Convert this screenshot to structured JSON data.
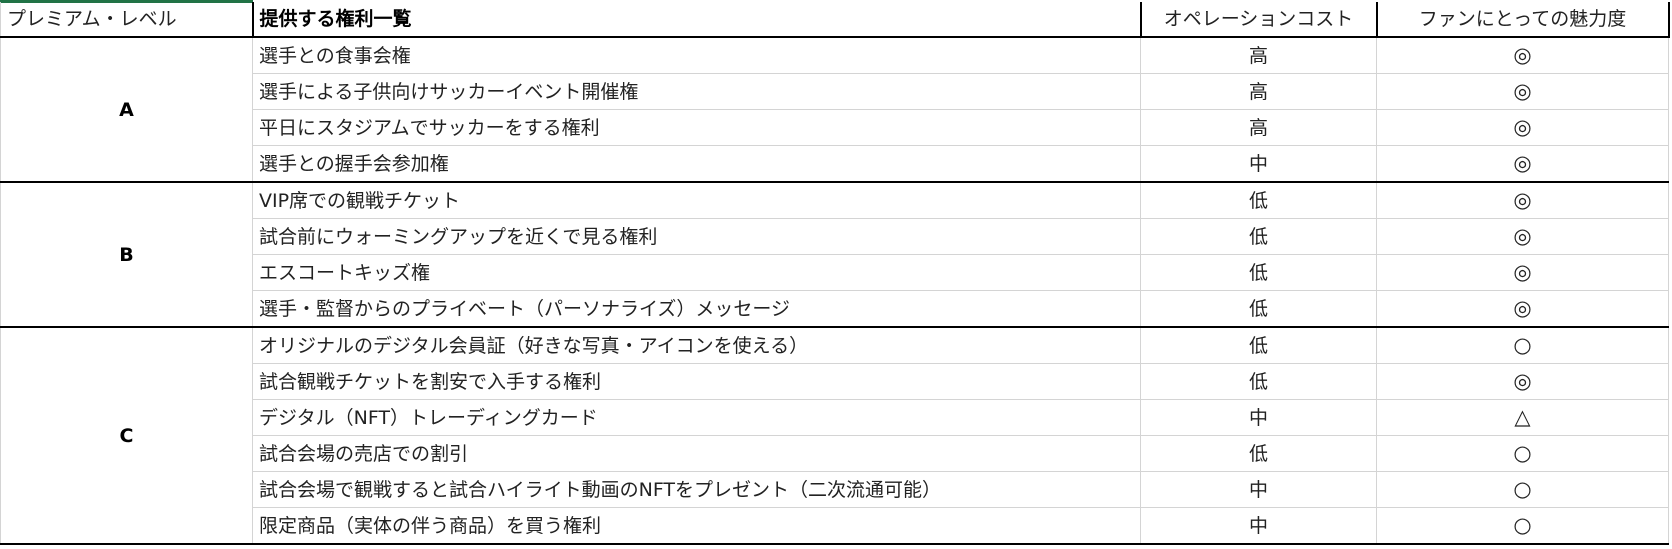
{
  "table": {
    "headers": {
      "level": "プレミアム・レベル",
      "rights": "提供する権利一覧",
      "cost": "オペレーションコスト",
      "appeal": "ファンにとっての魅力度"
    },
    "groups": [
      {
        "level": "A",
        "rows": [
          {
            "right": "選手との食事会権",
            "cost": "高",
            "appeal": "◎"
          },
          {
            "right": "選手による子供向けサッカーイベント開催権",
            "cost": "高",
            "appeal": "◎"
          },
          {
            "right": "平日にスタジアムでサッカーをする権利",
            "cost": "高",
            "appeal": "◎"
          },
          {
            "right": "選手との握手会参加権",
            "cost": "中",
            "appeal": "◎"
          }
        ]
      },
      {
        "level": "B",
        "rows": [
          {
            "right": "VIP席での観戦チケット",
            "cost": "低",
            "appeal": "◎"
          },
          {
            "right": "試合前にウォーミングアップを近くで見る権利",
            "cost": "低",
            "appeal": "◎"
          },
          {
            "right": "エスコートキッズ権",
            "cost": "低",
            "appeal": "◎"
          },
          {
            "right": "選手・監督からのプライベート（パーソナライズ）メッセージ",
            "cost": "低",
            "appeal": "◎"
          }
        ]
      },
      {
        "level": "C",
        "rows": [
          {
            "right": "オリジナルのデジタル会員証（好きな写真・アイコンを使える）",
            "cost": "低",
            "appeal": "○"
          },
          {
            "right": "試合観戦チケットを割安で入手する権利",
            "cost": "低",
            "appeal": "◎"
          },
          {
            "right": "デジタル（NFT）トレーディングカード",
            "cost": "中",
            "appeal": "△"
          },
          {
            "right": "試合会場の売店での割引",
            "cost": "低",
            "appeal": "○"
          },
          {
            "right": "試合会場で観戦すると試合ハイライト動画のNFTをプレゼント（二次流通可能）",
            "cost": "中",
            "appeal": "○"
          },
          {
            "right": "限定商品（実体の伴う商品）を買う権利",
            "cost": "中",
            "appeal": "○"
          }
        ]
      }
    ]
  },
  "colors": {
    "accent": "#217346",
    "gridline": "#d4d4d4",
    "border": "#000000"
  }
}
